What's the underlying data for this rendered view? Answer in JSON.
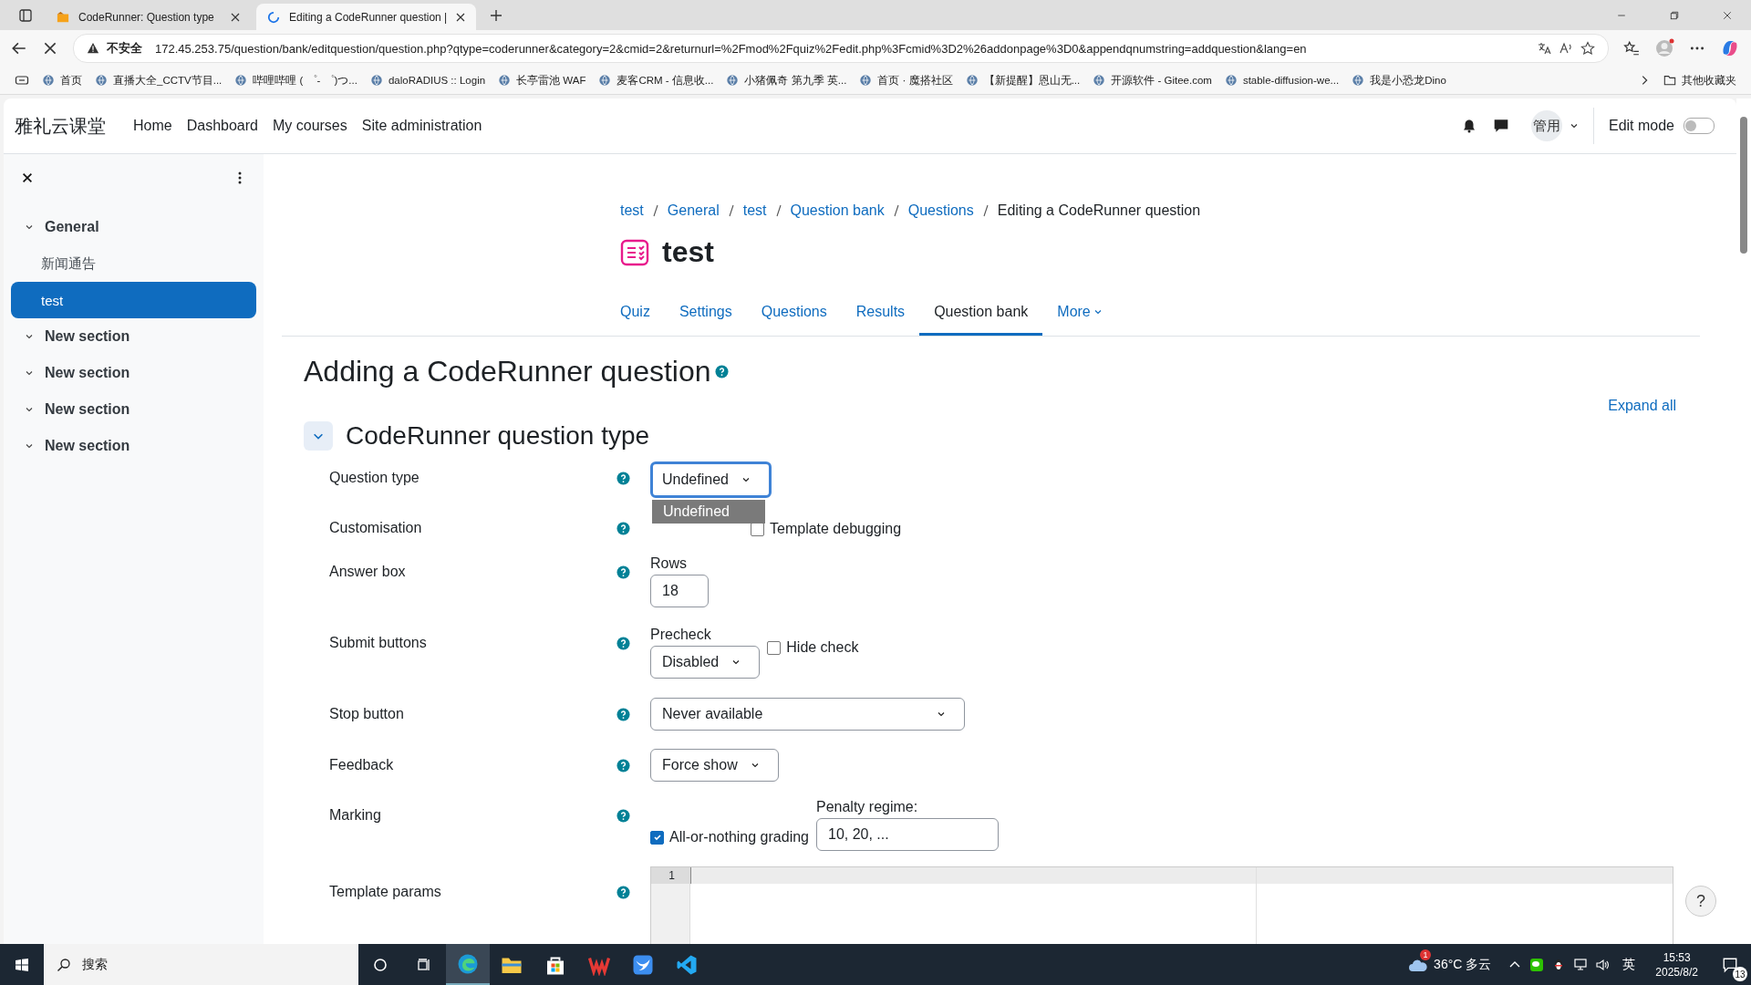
{
  "browser": {
    "tabs": [
      {
        "title": "CodeRunner: Question type",
        "selected": false,
        "loading": false
      },
      {
        "title": "Editing a CodeRunner question |",
        "selected": true,
        "loading": true
      }
    ],
    "address": {
      "warning": "不安全",
      "url": "172.45.253.75/question/bank/editquestion/question.php?qtype=coderunner&category=2&cmid=2&returnurl=%2Fmod%2Fquiz%2Fedit.php%3Fcmid%3D2%26addonpage%3D0&appendqnumstring=addquestion&lang=en"
    },
    "bookmarks": [
      {
        "label": "首页"
      },
      {
        "label": "直播大全_CCTV节目..."
      },
      {
        "label": "哔哩哔哩 ( ゜- ゜)つ..."
      },
      {
        "label": "daloRADIUS :: Login"
      },
      {
        "label": "长亭雷池 WAF"
      },
      {
        "label": "麦客CRM - 信息收..."
      },
      {
        "label": "小猪佩奇 第九季 英..."
      },
      {
        "label": "首页 · 魔搭社区"
      },
      {
        "label": "【新提醒】恩山无..."
      },
      {
        "label": "开源软件 - Gitee.com"
      },
      {
        "label": "stable-diffusion-we..."
      },
      {
        "label": "我是小恐龙Dino"
      }
    ],
    "other_bookmarks": "其他收藏夹"
  },
  "site": {
    "name": "雅礼云课堂",
    "nav": [
      "Home",
      "Dashboard",
      "My courses",
      "Site administration"
    ],
    "user": "管用",
    "edit_mode": {
      "label": "Edit mode",
      "on": false
    }
  },
  "sidebar": {
    "sections": [
      {
        "title": "General",
        "expanded": true,
        "children": [
          {
            "label": "新闻通告",
            "selected": false
          },
          {
            "label": "test",
            "selected": true
          }
        ]
      },
      {
        "title": "New section",
        "expanded": true
      },
      {
        "title": "New section",
        "expanded": true
      },
      {
        "title": "New section",
        "expanded": true
      },
      {
        "title": "New section",
        "expanded": true
      }
    ]
  },
  "breadcrumb": [
    {
      "label": "test",
      "link": true
    },
    {
      "label": "General",
      "link": true
    },
    {
      "label": "test",
      "link": true
    },
    {
      "label": "Question bank",
      "link": true
    },
    {
      "label": "Questions",
      "link": true
    },
    {
      "label": "Editing a CodeRunner question",
      "link": false
    }
  ],
  "page_title": "test",
  "tabs": [
    {
      "label": "Quiz",
      "selected": false
    },
    {
      "label": "Settings",
      "selected": false
    },
    {
      "label": "Questions",
      "selected": false
    },
    {
      "label": "Results",
      "selected": false
    },
    {
      "label": "Question bank",
      "selected": true
    },
    {
      "label": "More",
      "selected": false
    }
  ],
  "heading": "Adding a CodeRunner question",
  "expand_all": "Expand all",
  "section": {
    "title": "CodeRunner question type",
    "expanded": true
  },
  "form": [
    {
      "label": "Question type",
      "kind": "select",
      "value": "Undefined",
      "focused": true,
      "open_option": "Undefined"
    },
    {
      "label": "Customisation",
      "kind": "checks",
      "checks": [
        {
          "label": "Template debugging",
          "checked": false
        }
      ]
    },
    {
      "label": "Answer box",
      "kind": "number",
      "caption": "Rows",
      "value": "18"
    },
    {
      "label": "Submit buttons",
      "kind": "selectcheck",
      "caption": "Precheck",
      "value": "Disabled",
      "check": {
        "label": "Hide check",
        "checked": false
      }
    },
    {
      "label": "Stop button",
      "kind": "wideselect",
      "value": "Never available"
    },
    {
      "label": "Feedback",
      "kind": "select",
      "value": "Force show",
      "focused": false
    },
    {
      "label": "Marking",
      "kind": "marking",
      "check": {
        "label": "All-or-nothing grading",
        "checked": true
      },
      "caption": "Penalty regime:",
      "value": "10, 20, ..."
    },
    {
      "label": "Template params",
      "kind": "code",
      "lines": [
        "1"
      ]
    }
  ],
  "help_button": "?",
  "taskbar": {
    "search": "搜索",
    "weather_badge": "1",
    "weather": "36°C 多云",
    "ime": "英",
    "time": "15:53",
    "date": "2025/8/2",
    "notifications": "13"
  }
}
